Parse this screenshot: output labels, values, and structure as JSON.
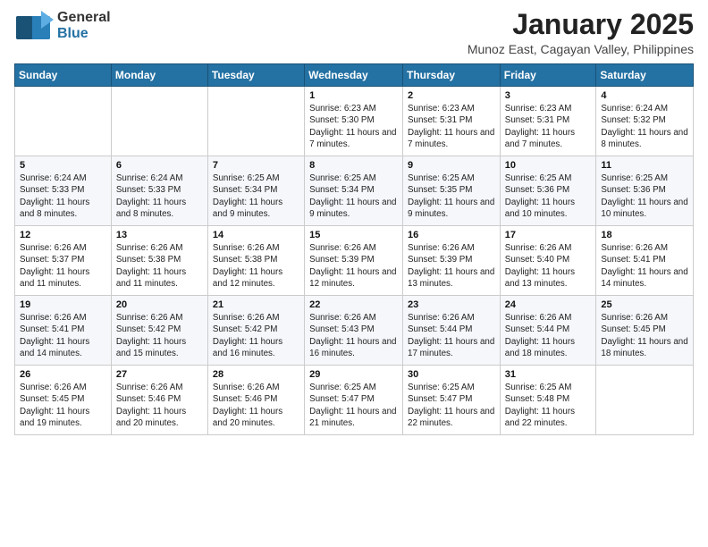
{
  "header": {
    "logo_general": "General",
    "logo_blue": "Blue",
    "month_title": "January 2025",
    "location": "Munoz East, Cagayan Valley, Philippines"
  },
  "weekdays": [
    "Sunday",
    "Monday",
    "Tuesday",
    "Wednesday",
    "Thursday",
    "Friday",
    "Saturday"
  ],
  "weeks": [
    [
      {
        "day": "",
        "sunrise": "",
        "sunset": "",
        "daylight": ""
      },
      {
        "day": "",
        "sunrise": "",
        "sunset": "",
        "daylight": ""
      },
      {
        "day": "",
        "sunrise": "",
        "sunset": "",
        "daylight": ""
      },
      {
        "day": "1",
        "sunrise": "Sunrise: 6:23 AM",
        "sunset": "Sunset: 5:30 PM",
        "daylight": "Daylight: 11 hours and 7 minutes."
      },
      {
        "day": "2",
        "sunrise": "Sunrise: 6:23 AM",
        "sunset": "Sunset: 5:31 PM",
        "daylight": "Daylight: 11 hours and 7 minutes."
      },
      {
        "day": "3",
        "sunrise": "Sunrise: 6:23 AM",
        "sunset": "Sunset: 5:31 PM",
        "daylight": "Daylight: 11 hours and 7 minutes."
      },
      {
        "day": "4",
        "sunrise": "Sunrise: 6:24 AM",
        "sunset": "Sunset: 5:32 PM",
        "daylight": "Daylight: 11 hours and 8 minutes."
      }
    ],
    [
      {
        "day": "5",
        "sunrise": "Sunrise: 6:24 AM",
        "sunset": "Sunset: 5:33 PM",
        "daylight": "Daylight: 11 hours and 8 minutes."
      },
      {
        "day": "6",
        "sunrise": "Sunrise: 6:24 AM",
        "sunset": "Sunset: 5:33 PM",
        "daylight": "Daylight: 11 hours and 8 minutes."
      },
      {
        "day": "7",
        "sunrise": "Sunrise: 6:25 AM",
        "sunset": "Sunset: 5:34 PM",
        "daylight": "Daylight: 11 hours and 9 minutes."
      },
      {
        "day": "8",
        "sunrise": "Sunrise: 6:25 AM",
        "sunset": "Sunset: 5:34 PM",
        "daylight": "Daylight: 11 hours and 9 minutes."
      },
      {
        "day": "9",
        "sunrise": "Sunrise: 6:25 AM",
        "sunset": "Sunset: 5:35 PM",
        "daylight": "Daylight: 11 hours and 9 minutes."
      },
      {
        "day": "10",
        "sunrise": "Sunrise: 6:25 AM",
        "sunset": "Sunset: 5:36 PM",
        "daylight": "Daylight: 11 hours and 10 minutes."
      },
      {
        "day": "11",
        "sunrise": "Sunrise: 6:25 AM",
        "sunset": "Sunset: 5:36 PM",
        "daylight": "Daylight: 11 hours and 10 minutes."
      }
    ],
    [
      {
        "day": "12",
        "sunrise": "Sunrise: 6:26 AM",
        "sunset": "Sunset: 5:37 PM",
        "daylight": "Daylight: 11 hours and 11 minutes."
      },
      {
        "day": "13",
        "sunrise": "Sunrise: 6:26 AM",
        "sunset": "Sunset: 5:38 PM",
        "daylight": "Daylight: 11 hours and 11 minutes."
      },
      {
        "day": "14",
        "sunrise": "Sunrise: 6:26 AM",
        "sunset": "Sunset: 5:38 PM",
        "daylight": "Daylight: 11 hours and 12 minutes."
      },
      {
        "day": "15",
        "sunrise": "Sunrise: 6:26 AM",
        "sunset": "Sunset: 5:39 PM",
        "daylight": "Daylight: 11 hours and 12 minutes."
      },
      {
        "day": "16",
        "sunrise": "Sunrise: 6:26 AM",
        "sunset": "Sunset: 5:39 PM",
        "daylight": "Daylight: 11 hours and 13 minutes."
      },
      {
        "day": "17",
        "sunrise": "Sunrise: 6:26 AM",
        "sunset": "Sunset: 5:40 PM",
        "daylight": "Daylight: 11 hours and 13 minutes."
      },
      {
        "day": "18",
        "sunrise": "Sunrise: 6:26 AM",
        "sunset": "Sunset: 5:41 PM",
        "daylight": "Daylight: 11 hours and 14 minutes."
      }
    ],
    [
      {
        "day": "19",
        "sunrise": "Sunrise: 6:26 AM",
        "sunset": "Sunset: 5:41 PM",
        "daylight": "Daylight: 11 hours and 14 minutes."
      },
      {
        "day": "20",
        "sunrise": "Sunrise: 6:26 AM",
        "sunset": "Sunset: 5:42 PM",
        "daylight": "Daylight: 11 hours and 15 minutes."
      },
      {
        "day": "21",
        "sunrise": "Sunrise: 6:26 AM",
        "sunset": "Sunset: 5:42 PM",
        "daylight": "Daylight: 11 hours and 16 minutes."
      },
      {
        "day": "22",
        "sunrise": "Sunrise: 6:26 AM",
        "sunset": "Sunset: 5:43 PM",
        "daylight": "Daylight: 11 hours and 16 minutes."
      },
      {
        "day": "23",
        "sunrise": "Sunrise: 6:26 AM",
        "sunset": "Sunset: 5:44 PM",
        "daylight": "Daylight: 11 hours and 17 minutes."
      },
      {
        "day": "24",
        "sunrise": "Sunrise: 6:26 AM",
        "sunset": "Sunset: 5:44 PM",
        "daylight": "Daylight: 11 hours and 18 minutes."
      },
      {
        "day": "25",
        "sunrise": "Sunrise: 6:26 AM",
        "sunset": "Sunset: 5:45 PM",
        "daylight": "Daylight: 11 hours and 18 minutes."
      }
    ],
    [
      {
        "day": "26",
        "sunrise": "Sunrise: 6:26 AM",
        "sunset": "Sunset: 5:45 PM",
        "daylight": "Daylight: 11 hours and 19 minutes."
      },
      {
        "day": "27",
        "sunrise": "Sunrise: 6:26 AM",
        "sunset": "Sunset: 5:46 PM",
        "daylight": "Daylight: 11 hours and 20 minutes."
      },
      {
        "day": "28",
        "sunrise": "Sunrise: 6:26 AM",
        "sunset": "Sunset: 5:46 PM",
        "daylight": "Daylight: 11 hours and 20 minutes."
      },
      {
        "day": "29",
        "sunrise": "Sunrise: 6:25 AM",
        "sunset": "Sunset: 5:47 PM",
        "daylight": "Daylight: 11 hours and 21 minutes."
      },
      {
        "day": "30",
        "sunrise": "Sunrise: 6:25 AM",
        "sunset": "Sunset: 5:47 PM",
        "daylight": "Daylight: 11 hours and 22 minutes."
      },
      {
        "day": "31",
        "sunrise": "Sunrise: 6:25 AM",
        "sunset": "Sunset: 5:48 PM",
        "daylight": "Daylight: 11 hours and 22 minutes."
      },
      {
        "day": "",
        "sunrise": "",
        "sunset": "",
        "daylight": ""
      }
    ]
  ]
}
